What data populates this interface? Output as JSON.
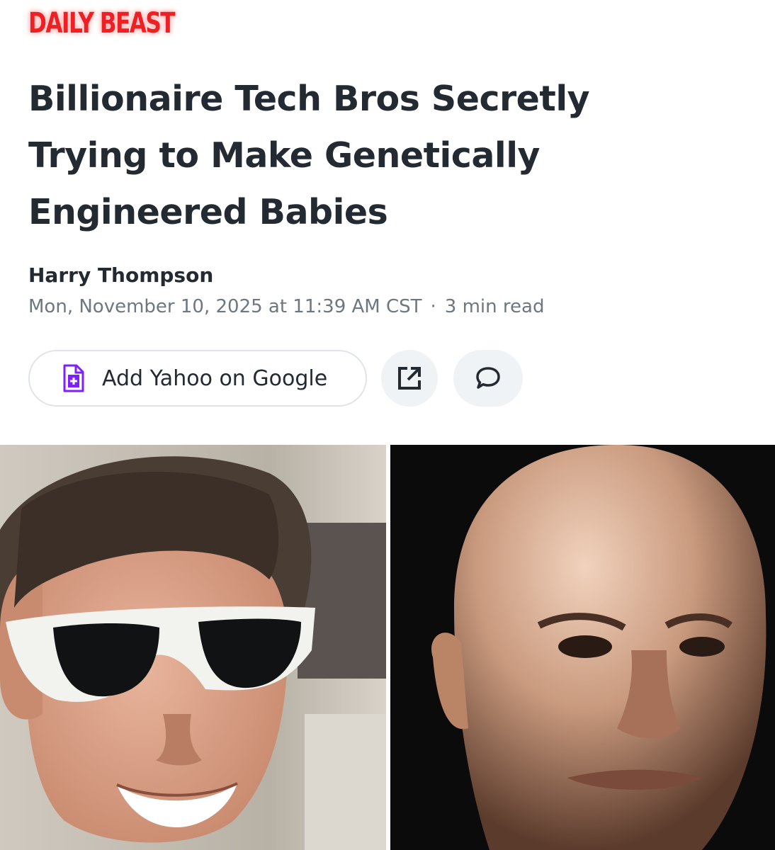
{
  "brand": {
    "logo_text": "DAILY BEAST"
  },
  "article": {
    "headline": "Billionaire Tech Bros Secretly Trying to Make Genetically Engineered Babies",
    "author": "Harry Thompson",
    "date": "Mon, November 10, 2025 at 11:39 AM CST",
    "separator": "·",
    "read_time": "3 min read"
  },
  "actions": {
    "add_source_label": "Add Yahoo on Google",
    "add_source_icon": "document-plus-icon",
    "share_icon": "external-share-icon",
    "comment_icon": "speech-bubble-icon"
  },
  "colors": {
    "brand_red": "#ed2024",
    "accent_purple": "#7e1fff",
    "text_dark": "#232a31",
    "text_muted": "#6e7780"
  },
  "images": {
    "left": "man-white-sunglasses-photo",
    "right": "bald-man-portrait-photo"
  }
}
